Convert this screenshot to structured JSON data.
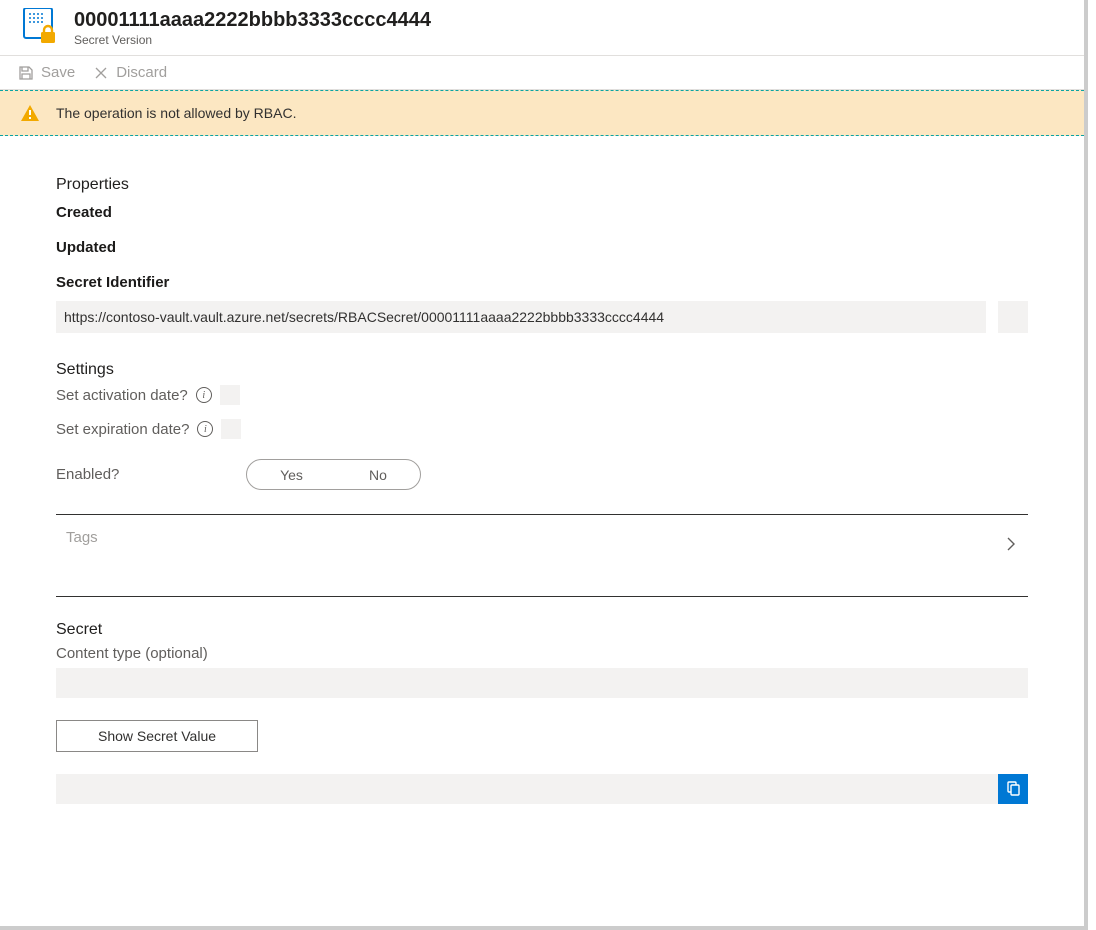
{
  "header": {
    "title": "00001111aaaa2222bbbb3333cccc4444",
    "subtitle": "Secret Version"
  },
  "toolbar": {
    "save_label": "Save",
    "discard_label": "Discard"
  },
  "warning": {
    "message": "The operation is not allowed by RBAC."
  },
  "properties": {
    "section_title": "Properties",
    "created_label": "Created",
    "updated_label": "Updated",
    "secret_identifier_label": "Secret Identifier",
    "secret_identifier_value": "https://contoso-vault.vault.azure.net/secrets/RBACSecret/00001111aaaa2222bbbb3333cccc4444"
  },
  "settings": {
    "section_title": "Settings",
    "activation_label": "Set activation date?",
    "expiration_label": "Set expiration date?",
    "enabled_label": "Enabled?",
    "toggle_yes": "Yes",
    "toggle_no": "No"
  },
  "tags": {
    "label": "Tags"
  },
  "secret": {
    "section_title": "Secret",
    "content_type_label": "Content type (optional)",
    "show_secret_label": "Show Secret Value"
  }
}
